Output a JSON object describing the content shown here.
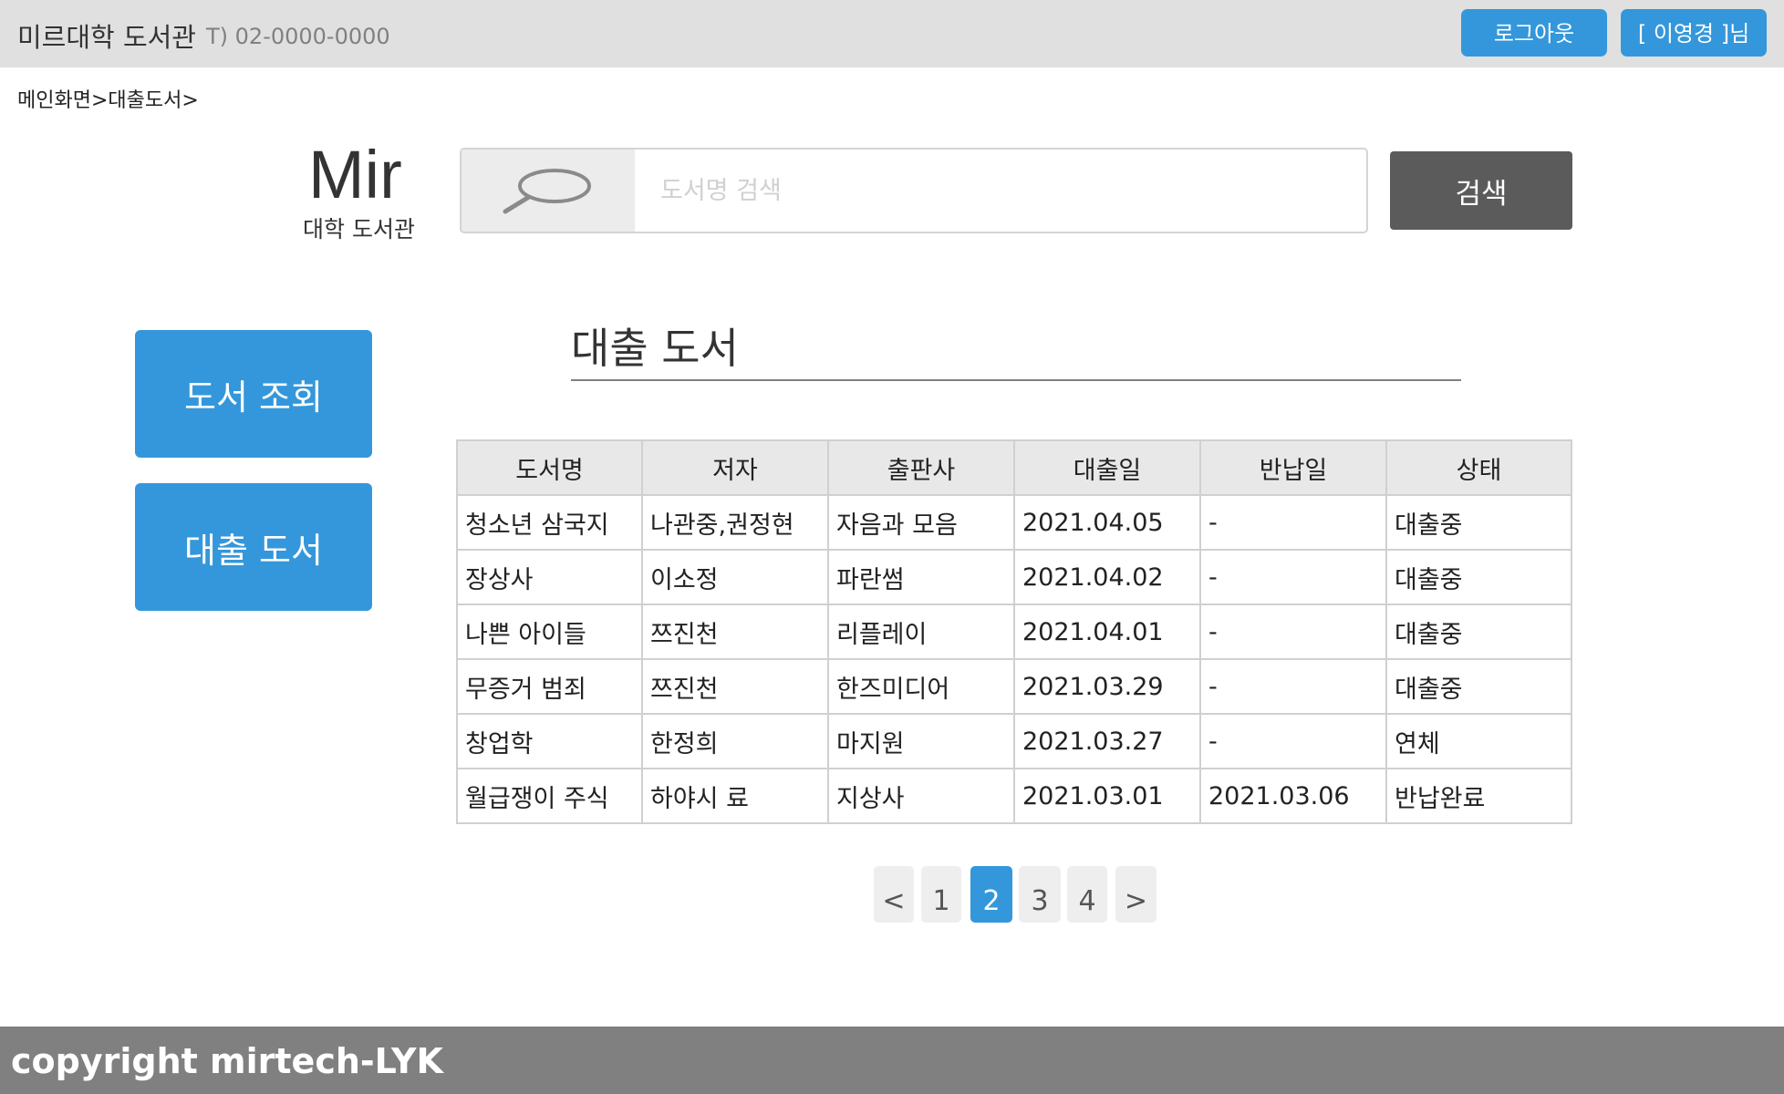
{
  "header": {
    "site_name": "미르대학 도서관",
    "phone": "T) 02-0000-0000",
    "logout_label": "로그아웃",
    "user_label": "[ 이영경 ]님"
  },
  "breadcrumb": "메인화면>대출도서>",
  "logo": {
    "main": "Mir",
    "sub": "대학 도서관"
  },
  "search": {
    "placeholder": "도서명 검색",
    "value": "",
    "button_label": "검색",
    "icon": "search-icon"
  },
  "side_menu": {
    "items": [
      {
        "label": "도서 조회"
      },
      {
        "label": "대출 도서"
      }
    ]
  },
  "main": {
    "title": "대출 도서",
    "table": {
      "headers": [
        "도서명",
        "저자",
        "출판사",
        "대출일",
        "반납일",
        "상태"
      ],
      "rows": [
        [
          "청소년 삼국지",
          "나관중,권정현",
          "자음과 모음",
          "2021.04.05",
          "-",
          "대출중"
        ],
        [
          "장상사",
          "이소정",
          "파란썸",
          "2021.04.02",
          "-",
          "대출중"
        ],
        [
          "나쁜 아이들",
          "쯔진천",
          "리플레이",
          "2021.04.01",
          "-",
          "대출중"
        ],
        [
          "무증거 범죄",
          "쯔진천",
          "한즈미디어",
          "2021.03.29",
          "-",
          "대출중"
        ],
        [
          "창업학",
          "한정희",
          "마지원",
          "2021.03.27",
          "-",
          "연체"
        ],
        [
          "월급쟁이 주식",
          "하야시 료",
          "지상사",
          "2021.03.01",
          "2021.03.06",
          "반납완료"
        ]
      ]
    },
    "pagination": {
      "prev": "<",
      "pages": [
        "1",
        "2",
        "3",
        "4"
      ],
      "current": "2",
      "next": ">"
    }
  },
  "footer": {
    "text": "copyright mirtech-LYK"
  },
  "colors": {
    "accent": "#3497db",
    "topbar_bg": "#e0e0e0",
    "search_button_bg": "#5b5b5b",
    "footer_bg": "#808080",
    "table_header_bg": "#e8e8e8"
  }
}
